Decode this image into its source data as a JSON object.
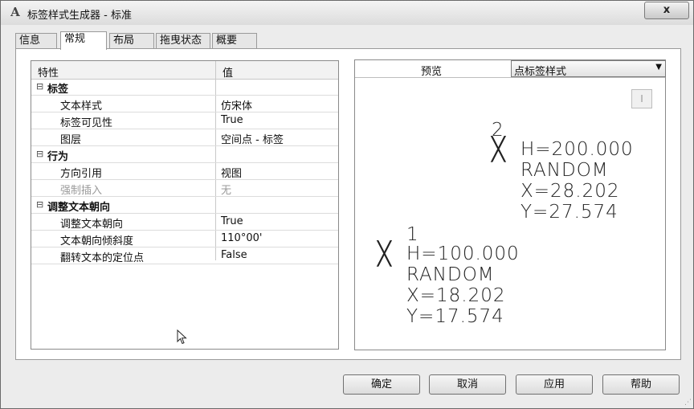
{
  "window": {
    "title": "标签样式生成器 - 标准",
    "app_icon": "A",
    "close_label": "x"
  },
  "tabs": [
    {
      "label": "信息",
      "active": false
    },
    {
      "label": "常规",
      "active": true
    },
    {
      "label": "布局",
      "active": false
    },
    {
      "label": "拖曳状态",
      "active": false
    },
    {
      "label": "概要",
      "active": false
    }
  ],
  "grid": {
    "header_property": "特性",
    "header_value": "值",
    "rows": [
      {
        "type": "category",
        "expander": "⊟",
        "property": "标签",
        "value": ""
      },
      {
        "type": "item",
        "property": "文本样式",
        "value": "仿宋体"
      },
      {
        "type": "item",
        "property": "标签可见性",
        "value": "True"
      },
      {
        "type": "item",
        "property": "图层",
        "value": "空间点 - 标签"
      },
      {
        "type": "category",
        "expander": "⊟",
        "property": "行为",
        "value": ""
      },
      {
        "type": "item",
        "property": "方向引用",
        "value": "视图"
      },
      {
        "type": "item",
        "property": "强制插入",
        "value": "无",
        "disabled": true
      },
      {
        "type": "category",
        "expander": "⊟",
        "property": "调整文本朝向",
        "value": ""
      },
      {
        "type": "item",
        "property": "调整文本朝向",
        "value": "True"
      },
      {
        "type": "item",
        "property": "文本朝向倾斜度",
        "value": "110°00'"
      },
      {
        "type": "item",
        "property": "翻转文本的定位点",
        "value": "False"
      }
    ]
  },
  "preview": {
    "label": "预览",
    "style_value": "点标签样式",
    "mini_button": "I",
    "points": [
      {
        "marker": "╳",
        "lines": [
          "2",
          "H=200.000",
          "RANDOM",
          "X=28.202",
          "Y=27.574"
        ]
      },
      {
        "marker": "╳",
        "lines": [
          "1",
          "H=100.000",
          "RANDOM",
          "X=18.202",
          "Y=17.574"
        ]
      }
    ]
  },
  "buttons": {
    "ok": "确定",
    "cancel": "取消",
    "apply": "应用",
    "help": "帮助"
  }
}
